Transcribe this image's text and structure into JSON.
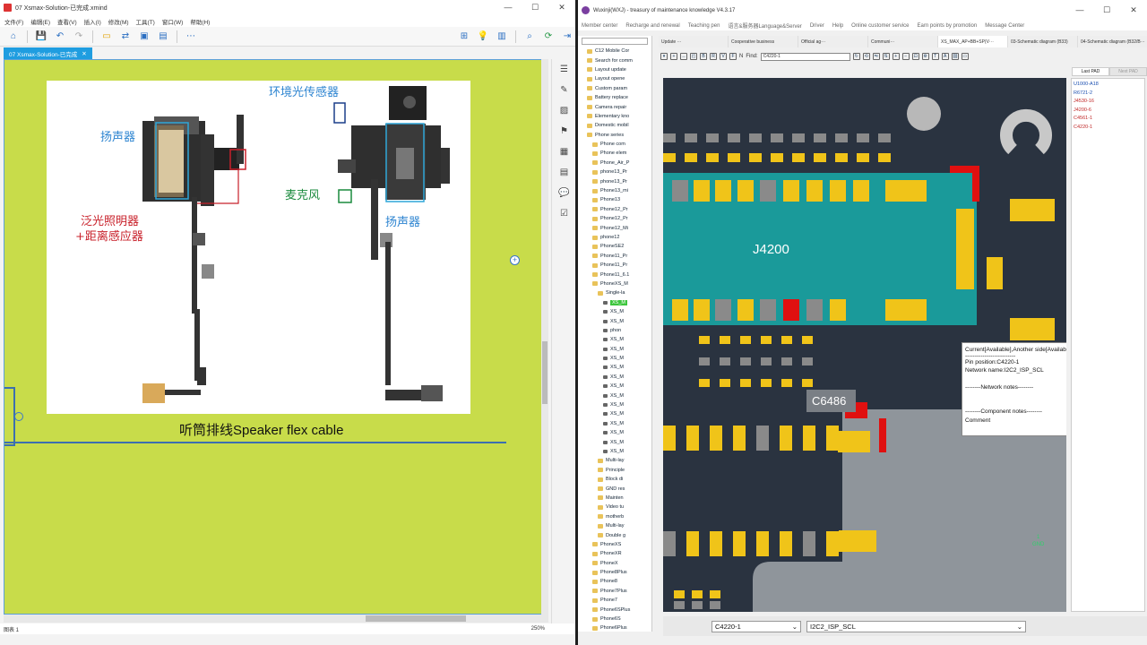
{
  "left_window": {
    "title": "07 Xsmax-Solution-已完成.xmind",
    "menu": [
      "文件(F)",
      "编辑(E)",
      "查看(V)",
      "插入(I)",
      "修改(M)",
      "工具(T)",
      "窗口(W)",
      "帮助(H)"
    ],
    "doc_tab": "07 Xsmax-Solution-已完成",
    "caption": "听筒排线Speaker flex cable",
    "labels": {
      "ambient_light_sensor": "环境光传感器",
      "speaker_left": "扬声器",
      "speaker_right": "扬声器",
      "microphone": "麦克风",
      "flood_illuminator_line1": "泛光照明器",
      "flood_illuminator_line2": "+距离感应器"
    },
    "status": {
      "sheet": "图表 1",
      "zoom": "250%"
    }
  },
  "right_window": {
    "title": "Wuxinji(WXJ) - treasury of maintenance knowledge V4.3.17",
    "menu": [
      "Member center",
      "Recharge and renewal",
      "Teaching pen",
      "语言&服务器Language&Server",
      "Driver",
      "Help",
      "Online customer service",
      "Earn points by promotion",
      "Message Center"
    ],
    "tree": [
      {
        "label": "C12 Mobile Cor",
        "type": "folder",
        "indent": 1
      },
      {
        "label": "Search for comm",
        "type": "folder",
        "indent": 1
      },
      {
        "label": "Layout update",
        "type": "folder",
        "indent": 1
      },
      {
        "label": "Layout opene",
        "type": "folder",
        "indent": 1
      },
      {
        "label": "Custom param",
        "type": "folder",
        "indent": 1
      },
      {
        "label": "Battery replace",
        "type": "folder",
        "indent": 1
      },
      {
        "label": "Camera repair",
        "type": "folder",
        "indent": 1
      },
      {
        "label": "Elementary kno",
        "type": "folder",
        "indent": 1
      },
      {
        "label": "Domestic mobil",
        "type": "folder",
        "indent": 1
      },
      {
        "label": "Phone series",
        "type": "folder",
        "indent": 1
      },
      {
        "label": "Phone com",
        "type": "folder",
        "indent": 2
      },
      {
        "label": "Phone elem",
        "type": "folder",
        "indent": 2
      },
      {
        "label": "Phone_Air_P",
        "type": "folder",
        "indent": 2
      },
      {
        "label": "phone13_Pr",
        "type": "folder",
        "indent": 2
      },
      {
        "label": "phone13_Pr",
        "type": "folder",
        "indent": 2
      },
      {
        "label": "Phone13_mi",
        "type": "folder",
        "indent": 2
      },
      {
        "label": "Phone13",
        "type": "folder",
        "indent": 2
      },
      {
        "label": "Phone12_Pr",
        "type": "folder",
        "indent": 2
      },
      {
        "label": "Phone12_Pr",
        "type": "folder",
        "indent": 2
      },
      {
        "label": "Phone12_Mi",
        "type": "folder",
        "indent": 2
      },
      {
        "label": "phone12",
        "type": "folder",
        "indent": 2
      },
      {
        "label": "PhoneSE2",
        "type": "folder",
        "indent": 2
      },
      {
        "label": "Phone11_Pr",
        "type": "folder",
        "indent": 2
      },
      {
        "label": "Phone11_Pr",
        "type": "folder",
        "indent": 2
      },
      {
        "label": "Phone11_6.1",
        "type": "folder",
        "indent": 2
      },
      {
        "label": "PhoneXS_M",
        "type": "folder",
        "indent": 2
      },
      {
        "label": "Single-la",
        "type": "folder",
        "indent": 3
      },
      {
        "label": "XS_M",
        "type": "doc",
        "indent": 4,
        "selected": true
      },
      {
        "label": "XS_M",
        "type": "doc",
        "indent": 4
      },
      {
        "label": "XS_M",
        "type": "doc",
        "indent": 4
      },
      {
        "label": "phon",
        "type": "doc",
        "indent": 4
      },
      {
        "label": "XS_M",
        "type": "doc",
        "indent": 4
      },
      {
        "label": "XS_M",
        "type": "doc",
        "indent": 4
      },
      {
        "label": "XS_M",
        "type": "doc",
        "indent": 4
      },
      {
        "label": "XS_M",
        "type": "doc",
        "indent": 4
      },
      {
        "label": "XS_M",
        "type": "doc",
        "indent": 4
      },
      {
        "label": "XS_M",
        "type": "doc",
        "indent": 4
      },
      {
        "label": "XS_M",
        "type": "doc",
        "indent": 4
      },
      {
        "label": "XS_M",
        "type": "doc",
        "indent": 4
      },
      {
        "label": "XS_M",
        "type": "doc",
        "indent": 4
      },
      {
        "label": "XS_M",
        "type": "doc",
        "indent": 4
      },
      {
        "label": "XS_M",
        "type": "doc",
        "indent": 4
      },
      {
        "label": "XS_M",
        "type": "doc",
        "indent": 4
      },
      {
        "label": "XS_M",
        "type": "doc",
        "indent": 4
      },
      {
        "label": "Multi-lay",
        "type": "folder",
        "indent": 3
      },
      {
        "label": "Principle",
        "type": "folder",
        "indent": 3
      },
      {
        "label": "Block di",
        "type": "folder",
        "indent": 3
      },
      {
        "label": "GND res",
        "type": "folder",
        "indent": 3
      },
      {
        "label": "Mainten",
        "type": "folder",
        "indent": 3
      },
      {
        "label": "Video tu",
        "type": "folder",
        "indent": 3
      },
      {
        "label": "motherb",
        "type": "folder",
        "indent": 3
      },
      {
        "label": "Multi-lay",
        "type": "folder",
        "indent": 3
      },
      {
        "label": "Double g",
        "type": "folder",
        "indent": 3
      },
      {
        "label": "PhoneXS",
        "type": "folder",
        "indent": 2
      },
      {
        "label": "PhoneXR",
        "type": "folder",
        "indent": 2
      },
      {
        "label": "PhoneX",
        "type": "folder",
        "indent": 2
      },
      {
        "label": "Phone8Plus",
        "type": "folder",
        "indent": 2
      },
      {
        "label": "Phone8",
        "type": "folder",
        "indent": 2
      },
      {
        "label": "Phone7Plus",
        "type": "folder",
        "indent": 2
      },
      {
        "label": "Phone7",
        "type": "folder",
        "indent": 2
      },
      {
        "label": "Phone6SPlus",
        "type": "folder",
        "indent": 2
      },
      {
        "label": "Phone6S",
        "type": "folder",
        "indent": 2
      },
      {
        "label": "Phone6Plus",
        "type": "folder",
        "indent": 2
      }
    ],
    "tabs": [
      "Update ···",
      "Cooperative business",
      "Official ag···",
      "Communi···",
      "XS_MAX_AP+BB+SP(V···",
      "03-Schematic diagram (B33)",
      "04-Schematic diagram (B32/B···"
    ],
    "active_tab": 4,
    "find_label": "Find:",
    "find_value": "C4220-1",
    "pad_tabs": [
      "Last PAD",
      "Next PAD"
    ],
    "pad_list": [
      {
        "name": "U1000-A18",
        "color": "#1b4fb0"
      },
      {
        "name": "R6721-2",
        "color": "#1b4fb0"
      },
      {
        "name": "J4530-16",
        "color": "#c02828"
      },
      {
        "name": "J4200-6",
        "color": "#c02828"
      },
      {
        "name": "C4561-1",
        "color": "#c02828"
      },
      {
        "name": "C4220-1",
        "color": "#c02828"
      }
    ],
    "tooltip": {
      "line1": "Current[Available],Another side[Available]",
      "line2": "--------------------------",
      "line3": "Pin position:C4220-1",
      "line4": "Network name:I2C2_ISP_SCL",
      "line5": "--------Network notes--------",
      "line6": "--------Component notes--------",
      "line7": "Comment"
    },
    "board": {
      "connector_label": "J4200",
      "big_pad_label": "C6486",
      "gnd_label": "GND",
      "gnd_num": "1"
    },
    "bottom_combo1": "C4220-1",
    "bottom_combo2": "I2C2_ISP_SCL",
    "colors": {
      "board_bg": "#2a3340",
      "connector": "#1a9a9a",
      "pad_yellow": "#f0c419",
      "pad_grey": "#8a8a8a",
      "pad_red": "#e01010"
    }
  }
}
